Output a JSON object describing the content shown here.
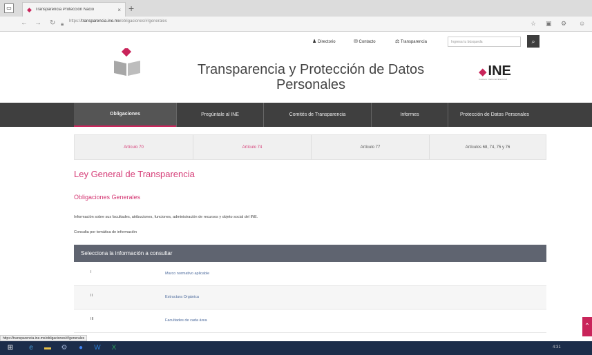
{
  "browser": {
    "tab_title": "Transparencia Protección Nacio",
    "tab_close": "×",
    "new_tab": "+",
    "url_prefix": "https://",
    "url_host": "transparencia.ine.mx",
    "url_path": "/obligaciones/#/generales"
  },
  "utility": {
    "directory": "Directorio",
    "contact": "Contacto",
    "transparency": "Transparencia",
    "search_placeholder": "Ingresa tu búsqueda"
  },
  "header": {
    "title": "Transparencia y Protección de Datos Personales",
    "ine_logo": "INE",
    "ine_subtitle": "Instituto Nacional Electoral"
  },
  "mainnav": [
    {
      "label": "Obligaciones",
      "active": true
    },
    {
      "label": "Pregúntale al INE",
      "active": false
    },
    {
      "label": "Comités de Transparencia",
      "active": false
    },
    {
      "label": "Informes",
      "active": false
    },
    {
      "label": "Protección de Datos Personales",
      "active": false
    }
  ],
  "subtabs": [
    {
      "label": "Artículo 70"
    },
    {
      "label": "Artículo 74"
    },
    {
      "label": "Artículo 77"
    },
    {
      "label": "Artículos 68, 74, 75 y 76"
    }
  ],
  "content": {
    "title": "Ley General de Transparencia",
    "subtitle": "Obligaciones Generales",
    "description": "Información sobre sus facultades, atribuciones, funciones, administración de recursos y objeto social del INE.",
    "consult": "Consulta por temática de información"
  },
  "table": {
    "header": "Selecciona la información a consultar",
    "rows": [
      {
        "num": "I",
        "label": "Marco normativo aplicable"
      },
      {
        "num": "II",
        "label": "Estructura Orgánica"
      },
      {
        "num": "III",
        "label": "Facultades de cada área"
      }
    ]
  },
  "status_url": "https://transparencia.ine.mx/obligaciones/#/generales",
  "taskbar": {
    "clock": "4:31"
  },
  "colors": {
    "accent": "#c9245a",
    "nav_bg": "#3f3f3f",
    "table_header": "#5f6470",
    "taskbar": "#1c2d4a"
  }
}
